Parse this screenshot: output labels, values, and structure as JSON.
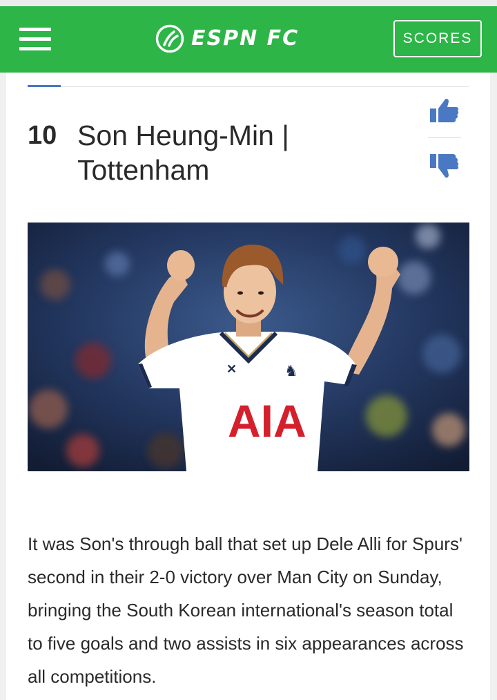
{
  "header": {
    "logo_text": "ESPN FC",
    "scores_label": "SCORES",
    "brand_color": "#2db548"
  },
  "article": {
    "rank": "10",
    "title": "Son Heung-Min | Tottenham",
    "body": "It was Son's through ball that set up Dele Alli for Spurs' second in their 2-0 victory over Man City on Sunday, bringing the South Korean international's season total to five goals and two assists in six appearances across all competitions.",
    "photo_shirt_text": "AIA"
  },
  "icons": {
    "menu": "hamburger-menu-icon",
    "logo": "soccer-ball-icon",
    "upvote": "thumbs-up-icon",
    "downvote": "thumbs-down-icon",
    "vote_color": "#4a78c2"
  }
}
